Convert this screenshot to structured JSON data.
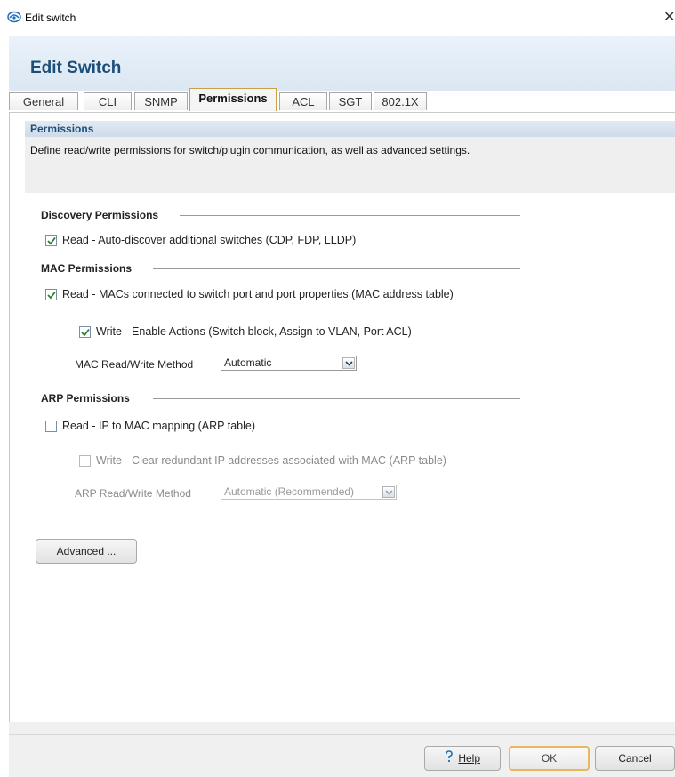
{
  "window": {
    "title": "Edit switch",
    "close_glyph": "✕"
  },
  "dialog": {
    "title": "Edit Switch"
  },
  "tabs": [
    {
      "label": "General"
    },
    {
      "label": "CLI"
    },
    {
      "label": "SNMP"
    },
    {
      "label": "Permissions",
      "active": true
    },
    {
      "label": "ACL"
    },
    {
      "label": "SGT"
    },
    {
      "label": "802.1X"
    }
  ],
  "section": {
    "title": "Permissions",
    "description": "Define read/write permissions for switch/plugin communication, as well as advanced settings."
  },
  "discovery": {
    "title": "Discovery Permissions",
    "read_label": "Read  - Auto-discover additional switches (CDP, FDP, LLDP)",
    "read_checked": true
  },
  "mac": {
    "title": "MAC Permissions",
    "read_label": "Read  - MACs connected to switch port and port properties (MAC address table)",
    "read_checked": true,
    "write_label": "Write - Enable Actions (Switch block, Assign to VLAN, Port ACL)",
    "write_checked": true,
    "method_label": "MAC Read/Write Method",
    "method_value": "Automatic"
  },
  "arp": {
    "title": "ARP Permissions",
    "read_label": "Read  - IP to MAC mapping (ARP table)",
    "read_checked": false,
    "write_label": "Write - Clear redundant IP addresses associated with MAC (ARP table)",
    "write_checked": false,
    "method_label": "ARP Read/Write Method",
    "method_value": "Automatic (Recommended)"
  },
  "buttons": {
    "advanced": "Advanced ...",
    "help": "Help",
    "ok": "OK",
    "cancel": "Cancel"
  },
  "icons": {
    "app": "app-logo-icon",
    "help": "help-icon",
    "check": "checkmark-icon",
    "dropdown": "chevron-down-icon"
  },
  "colors": {
    "title_blue": "#1b4f7a",
    "check_green": "#2e7d32",
    "active_tab_border": "#c8a04a",
    "ok_border": "#e8b85a"
  }
}
